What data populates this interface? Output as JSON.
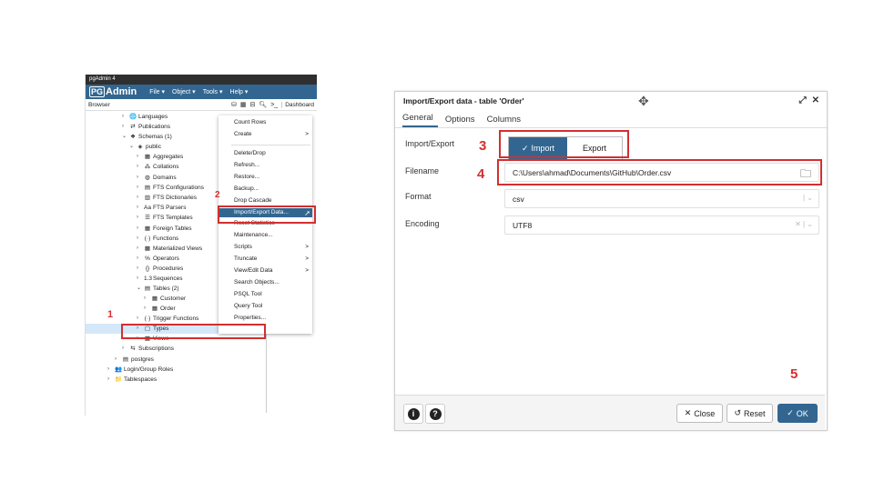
{
  "pgadmin": {
    "window_title": "pgAdmin 4",
    "logo_pg": "PG",
    "logo_text": "Admin",
    "menus": [
      "File ▾",
      "Object ▾",
      "Tools ▾",
      "Help ▾"
    ],
    "browser_label": "Browser",
    "dashboard_tab": "Dashboard",
    "tree": [
      {
        "label": "Languages",
        "indent": 40,
        "icon": "🌐",
        "chev": "›"
      },
      {
        "label": "Publications",
        "indent": 40,
        "icon": "⇄",
        "chev": "›"
      },
      {
        "label": "Schemas (1)",
        "indent": 40,
        "icon": "❖",
        "chev": "⌄"
      },
      {
        "label": "public",
        "indent": 48,
        "icon": "◈",
        "chev": "⌄"
      },
      {
        "label": "Aggregates",
        "indent": 56,
        "icon": "▦",
        "chev": "›"
      },
      {
        "label": "Collations",
        "indent": 56,
        "icon": "⁂",
        "chev": "›"
      },
      {
        "label": "Domains",
        "indent": 56,
        "icon": "◍",
        "chev": "›"
      },
      {
        "label": "FTS Configurations",
        "indent": 56,
        "icon": "▤",
        "chev": "›"
      },
      {
        "label": "FTS Dictionaries",
        "indent": 56,
        "icon": "▥",
        "chev": "›"
      },
      {
        "label": "FTS Parsers",
        "indent": 56,
        "icon": "Aa",
        "chev": "›"
      },
      {
        "label": "FTS Templates",
        "indent": 56,
        "icon": "☰",
        "chev": "›"
      },
      {
        "label": "Foreign Tables",
        "indent": 56,
        "icon": "▦",
        "chev": "›"
      },
      {
        "label": "Functions",
        "indent": 56,
        "icon": "(·)",
        "chev": "›"
      },
      {
        "label": "Materialized Views",
        "indent": 56,
        "icon": "▩",
        "chev": "›"
      },
      {
        "label": "Operators",
        "indent": 56,
        "icon": "%",
        "chev": "›"
      },
      {
        "label": "Procedures",
        "indent": 56,
        "icon": "{}",
        "chev": "›"
      },
      {
        "label": "Sequences",
        "indent": 56,
        "icon": "1.3",
        "chev": "›"
      },
      {
        "label": "Tables (2)",
        "indent": 56,
        "icon": "▤",
        "chev": "⌄"
      },
      {
        "label": "Customer",
        "indent": 64,
        "icon": "▦",
        "chev": "›"
      },
      {
        "label": "Order",
        "indent": 64,
        "icon": "▦",
        "chev": "›"
      },
      {
        "label": "Trigger Functions",
        "indent": 56,
        "icon": "(·)",
        "chev": "›"
      },
      {
        "label": "Types",
        "indent": 56,
        "icon": "▢",
        "chev": "›"
      },
      {
        "label": "Views",
        "indent": 56,
        "icon": "▩",
        "chev": "›"
      },
      {
        "label": "Subscriptions",
        "indent": 40,
        "icon": "⇆",
        "chev": "›"
      },
      {
        "label": "postgres",
        "indent": 32,
        "icon": "▤",
        "chev": "›"
      },
      {
        "label": "Login/Group Roles",
        "indent": 24,
        "icon": "👥",
        "chev": "›"
      },
      {
        "label": "Tablespaces",
        "indent": 24,
        "icon": "📁",
        "chev": "›"
      }
    ],
    "context_menu": [
      {
        "label": "Count Rows",
        "arrow": ""
      },
      {
        "label": "Create",
        "arrow": ">"
      },
      {
        "label": "Delete/Drop",
        "arrow": ""
      },
      {
        "label": "Refresh...",
        "arrow": ""
      },
      {
        "label": "Restore...",
        "arrow": ""
      },
      {
        "label": "Backup...",
        "arrow": ""
      },
      {
        "label": "Drop Cascade",
        "arrow": ""
      },
      {
        "label": "Import/Export Data...",
        "arrow": ""
      },
      {
        "label": "Reset Statistics",
        "arrow": ""
      },
      {
        "label": "Maintenance...",
        "arrow": ""
      },
      {
        "label": "Scripts",
        "arrow": ">"
      },
      {
        "label": "Truncate",
        "arrow": ">"
      },
      {
        "label": "View/Edit Data",
        "arrow": ">"
      },
      {
        "label": "Search Objects...",
        "arrow": ""
      },
      {
        "label": "PSQL Tool",
        "arrow": ""
      },
      {
        "label": "Query Tool",
        "arrow": ""
      },
      {
        "label": "Properties...",
        "arrow": ""
      }
    ]
  },
  "annotations": {
    "n1": "1",
    "n2": "2",
    "n3": "3",
    "n4": "4",
    "n5": "5"
  },
  "dialog": {
    "title": "Import/Export data - table 'Order'",
    "tabs": [
      "General",
      "Options",
      "Columns"
    ],
    "import_export_label": "Import/Export",
    "import_option": "Import",
    "export_option": "Export",
    "filename_label": "Filename",
    "filename_value": "C:\\Users\\ahmad\\Documents\\GitHub\\Order.csv",
    "format_label": "Format",
    "format_value": "csv",
    "encoding_label": "Encoding",
    "encoding_value": "UTF8",
    "close_label": "Close",
    "reset_label": "Reset",
    "ok_label": "OK"
  },
  "colors": {
    "brand": "#326690",
    "annotation": "#d32f2f"
  }
}
